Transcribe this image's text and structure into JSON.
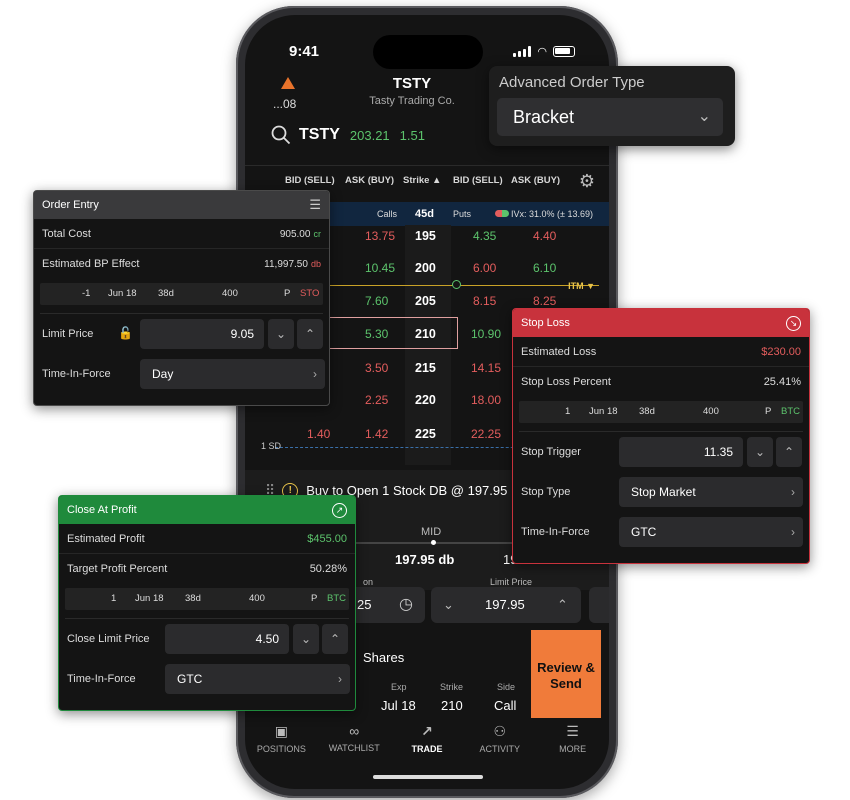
{
  "status": {
    "time": "9:41"
  },
  "header": {
    "account": "...08",
    "symbol": "TSTY",
    "company": "Tasty Trading Co."
  },
  "quote": {
    "symbol": "TSTY",
    "price": "203.21",
    "change": "1.51"
  },
  "chain": {
    "columns": [
      "BID (SELL)",
      "ASK (BUY)",
      "Strike",
      "BID (SELL)",
      "ASK (BUY)"
    ],
    "calls_label": "Calls",
    "days": "45d",
    "puts_label": "Puts",
    "ivx": "IVx: 31.0% (± 13.69)",
    "itm_label": "ITM",
    "sd_label": "1 SD",
    "rows": [
      {
        "cbid": "",
        "cask": "13.75",
        "strike": "195",
        "pbid": "4.35",
        "pask": "4.40"
      },
      {
        "cbid": "",
        "cask": "10.45",
        "strike": "200",
        "pbid": "6.00",
        "pask": "6.10"
      },
      {
        "cbid": "",
        "cask": "7.60",
        "strike": "205",
        "pbid": "8.15",
        "pask": "8.25"
      },
      {
        "cbid": "",
        "cask": "5.30",
        "strike": "210",
        "pbid": "10.90",
        "pask": ""
      },
      {
        "cbid": "",
        "cask": "3.50",
        "strike": "215",
        "pbid": "14.15",
        "pask": ""
      },
      {
        "cbid": "",
        "cask": "2.25",
        "strike": "220",
        "pbid": "18.00",
        "pask": ""
      },
      {
        "cbid": "1.40",
        "cask": "1.42",
        "strike": "225",
        "pbid": "22.25",
        "pask": ""
      }
    ]
  },
  "order": {
    "description": "Buy to Open 1 Stock DB @ 197.95",
    "mid_label": "MID",
    "mid_price": "197.95 db",
    "mid_price_left": "",
    "mid_price_right": "198",
    "limit_label": "Limit Price",
    "limit_value": "197.95",
    "left_label": "on",
    "left_value": "25",
    "shares_label": "Shares",
    "legs": {
      "exp_label": "Exp",
      "exp": "Jul 18",
      "strike_label": "Strike",
      "strike": "210",
      "side_label": "Side",
      "side": "Call"
    },
    "review_label": "Review & Send"
  },
  "tabs": [
    {
      "label": "POSITIONS",
      "icon": "briefcase-icon"
    },
    {
      "label": "WATCHLIST",
      "icon": "glasses-icon"
    },
    {
      "label": "TRADE",
      "icon": "trade-icon"
    },
    {
      "label": "ACTIVITY",
      "icon": "activity-icon"
    },
    {
      "label": "MORE",
      "icon": "more-icon"
    }
  ],
  "advanced": {
    "label": "Advanced Order Type",
    "value": "Bracket"
  },
  "order_entry": {
    "title": "Order Entry",
    "total_cost_label": "Total Cost",
    "total_cost": "905.00",
    "total_cost_suffix": "cr",
    "bp_label": "Estimated BP Effect",
    "bp": "11,997.50",
    "bp_suffix": "db",
    "leg": {
      "qty": "-1",
      "exp": "Jun 18",
      "dte": "38d",
      "strike": "400",
      "type": "P",
      "action": "STO"
    },
    "limit_label": "Limit Price",
    "limit_value": "9.05",
    "tif_label": "Time-In-Force",
    "tif_value": "Day"
  },
  "stop_loss": {
    "title": "Stop Loss",
    "est_loss_label": "Estimated Loss",
    "est_loss": "$230.00",
    "percent_label": "Stop Loss Percent",
    "percent": "25.41%",
    "leg": {
      "qty": "1",
      "exp": "Jun 18",
      "dte": "38d",
      "strike": "400",
      "type": "P",
      "action": "BTC"
    },
    "trigger_label": "Stop Trigger",
    "trigger_value": "11.35",
    "type_label": "Stop Type",
    "type_value": "Stop Market",
    "tif_label": "Time-In-Force",
    "tif_value": "GTC",
    "color": "#c8323c"
  },
  "take_profit": {
    "title": "Close At Profit",
    "est_profit_label": "Estimated Profit",
    "est_profit": "$455.00",
    "percent_label": "Target Profit Percent",
    "percent": "50.28%",
    "leg": {
      "qty": "1",
      "exp": "Jun 18",
      "dte": "38d",
      "strike": "400",
      "type": "P",
      "action": "BTC"
    },
    "limit_label": "Close Limit Price",
    "limit_value": "4.50",
    "tif_label": "Time-In-Force",
    "tif_value": "GTC",
    "color": "#1f8a3c"
  }
}
